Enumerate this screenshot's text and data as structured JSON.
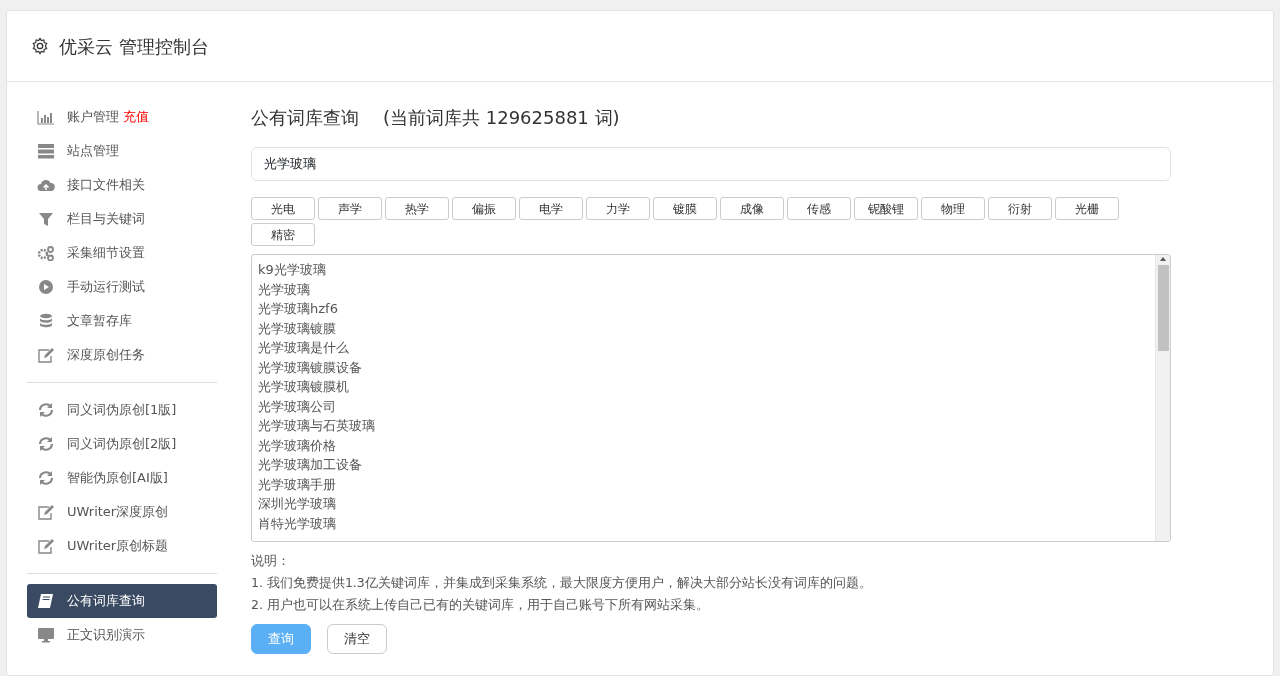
{
  "header": {
    "title": "优采云 管理控制台"
  },
  "sidebar": {
    "items": [
      {
        "kind": "link",
        "label": "账户管理",
        "badge": "充值",
        "selected": false
      },
      {
        "kind": "link",
        "label": "站点管理",
        "selected": false
      },
      {
        "kind": "link",
        "label": "接口文件相关",
        "selected": false
      },
      {
        "kind": "link",
        "label": "栏目与关键词",
        "selected": false
      },
      {
        "kind": "link",
        "label": "采集细节设置",
        "selected": false
      },
      {
        "kind": "link",
        "label": "手动运行测试",
        "selected": false
      },
      {
        "kind": "link",
        "label": "文章暂存库",
        "selected": false
      },
      {
        "kind": "link",
        "label": "深度原创任务",
        "selected": false
      },
      {
        "kind": "divider"
      },
      {
        "kind": "link",
        "label": "同义词伪原创[1版]",
        "selected": false
      },
      {
        "kind": "link",
        "label": "同义词伪原创[2版]",
        "selected": false
      },
      {
        "kind": "link",
        "label": "智能伪原创[AI版]",
        "selected": false
      },
      {
        "kind": "link",
        "label": "UWriter深度原创",
        "selected": false
      },
      {
        "kind": "link",
        "label": "UWriter原创标题",
        "selected": false
      },
      {
        "kind": "divider"
      },
      {
        "kind": "link",
        "label": "公有词库查询",
        "selected": true
      },
      {
        "kind": "link",
        "label": "正文识别演示",
        "selected": false
      }
    ]
  },
  "main": {
    "title": "公有词库查询",
    "count_text": "(当前词库共 129625881 词)",
    "search": {
      "value": "光学玻璃"
    },
    "tags": [
      "光电",
      "声学",
      "热学",
      "偏振",
      "电学",
      "力学",
      "镀膜",
      "成像",
      "传感",
      "铌酸锂",
      "物理",
      "衍射",
      "光栅",
      "精密"
    ],
    "results": [
      "k9光学玻璃",
      "光学玻璃",
      "光学玻璃hzf6",
      "光学玻璃镀膜",
      "光学玻璃是什么",
      "光学玻璃镀膜设备",
      "光学玻璃镀膜机",
      "光学玻璃公司",
      "光学玻璃与石英玻璃",
      "光学玻璃价格",
      "光学玻璃加工设备",
      "光学玻璃手册",
      "深圳光学玻璃",
      "肖特光学玻璃"
    ],
    "notes": [
      "说明：",
      "1. 我们免费提供1.3亿关键词库，并集成到采集系统，最大限度方便用户，解决大部分站长没有词库的问题。",
      "2. 用户也可以在系统上传自己已有的关键词库，用于自己账号下所有网站采集。"
    ],
    "buttons": [
      {
        "kind": "primary",
        "label": "查询"
      },
      {
        "kind": "secondary",
        "label": "清空"
      }
    ]
  }
}
